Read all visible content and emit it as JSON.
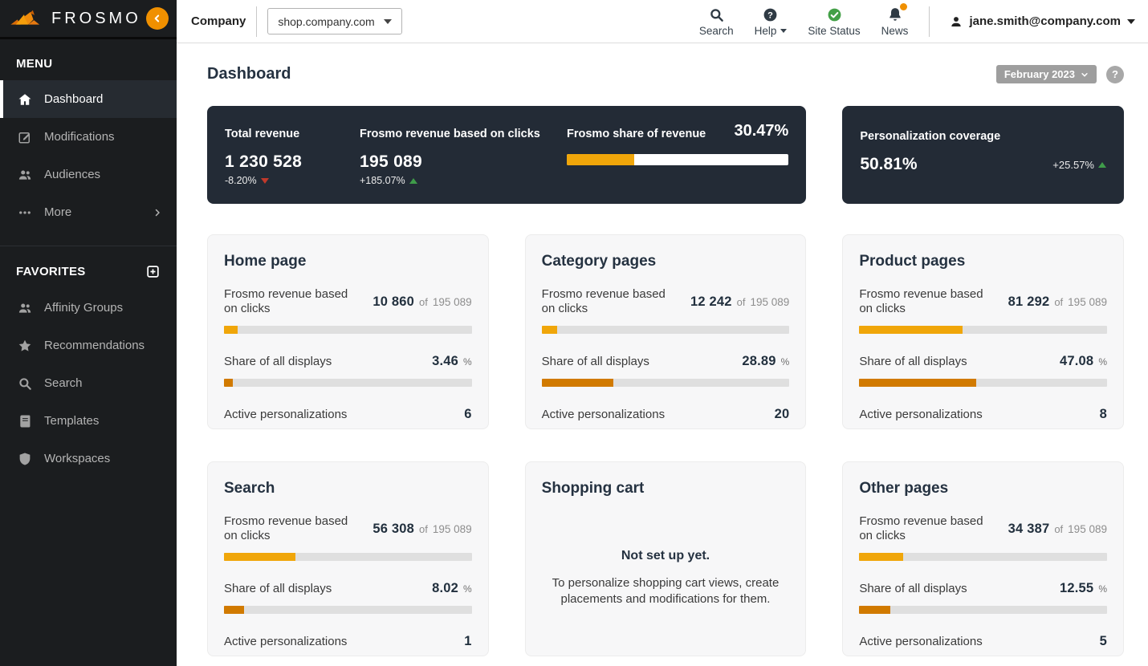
{
  "brand": {
    "name": "FROSMO"
  },
  "header": {
    "company_label": "Company",
    "site_selector": {
      "value": "shop.company.com"
    },
    "actions": {
      "search": "Search",
      "help": "Help",
      "site_status": "Site Status",
      "news": "News"
    },
    "user": {
      "email": "jane.smith@company.com"
    }
  },
  "sidebar": {
    "menu_title": "MENU",
    "menu_items": [
      {
        "label": "Dashboard",
        "icon": "home-icon",
        "active": true
      },
      {
        "label": "Modifications",
        "icon": "edit-icon",
        "active": false
      },
      {
        "label": "Audiences",
        "icon": "users-icon",
        "active": false
      },
      {
        "label": "More",
        "icon": "ellipsis-icon",
        "active": false
      }
    ],
    "favorites_title": "FAVORITES",
    "favorites_items": [
      {
        "label": "Affinity Groups",
        "icon": "users-icon"
      },
      {
        "label": "Recommendations",
        "icon": "star-icon"
      },
      {
        "label": "Search",
        "icon": "search-icon"
      },
      {
        "label": "Templates",
        "icon": "book-icon"
      },
      {
        "label": "Workspaces",
        "icon": "shield-icon"
      }
    ]
  },
  "page": {
    "title": "Dashboard",
    "period": "February 2023",
    "help": "?"
  },
  "overview": {
    "total_revenue": {
      "label": "Total revenue",
      "value": "1 230 528",
      "change": "-8.20%",
      "trend": "down"
    },
    "frosmo_revenue": {
      "label": "Frosmo revenue based on clicks",
      "value": "195 089",
      "change": "+185.07%",
      "trend": "up"
    },
    "share_of_revenue": {
      "label": "Frosmo share of revenue",
      "value": "30.47%",
      "bar_pct": 30.47
    },
    "personalization_coverage": {
      "label": "Personalization coverage",
      "value": "50.81%",
      "change": "+25.57%",
      "trend": "up"
    }
  },
  "labels": {
    "revenue_label": "Frosmo revenue based on clicks",
    "of": "of",
    "share_label": "Share of all displays",
    "active_label": "Active personalizations",
    "percent": "%"
  },
  "cards": [
    {
      "title": "Home page",
      "revenue": "10 860",
      "revenue_total": "195 089",
      "revenue_pct": 5.57,
      "share": "3.46",
      "share_pct": 3.46,
      "active": "6"
    },
    {
      "title": "Category pages",
      "revenue": "12 242",
      "revenue_total": "195 089",
      "revenue_pct": 6.27,
      "share": "28.89",
      "share_pct": 28.89,
      "active": "20"
    },
    {
      "title": "Product pages",
      "revenue": "81 292",
      "revenue_total": "195 089",
      "revenue_pct": 41.67,
      "share": "47.08",
      "share_pct": 47.08,
      "active": "8"
    },
    {
      "title": "Search",
      "revenue": "56 308",
      "revenue_total": "195 089",
      "revenue_pct": 28.86,
      "share": "8.02",
      "share_pct": 8.02,
      "active": "1"
    },
    {
      "title": "Shopping cart",
      "empty_title": "Not set up yet.",
      "empty_text": "To personalize shopping cart views, create placements and modifications for them."
    },
    {
      "title": "Other pages",
      "revenue": "34 387",
      "revenue_total": "195 089",
      "revenue_pct": 17.63,
      "share": "12.55",
      "share_pct": 12.55,
      "active": "5"
    }
  ],
  "colors": {
    "accent_orange": "#f0a60a",
    "dark_orange": "#d17a00",
    "brand_orange": "#f09000",
    "dark_card_bg": "#232b36",
    "positive_green": "#3f9c4a",
    "negative_red": "#c0392b"
  }
}
